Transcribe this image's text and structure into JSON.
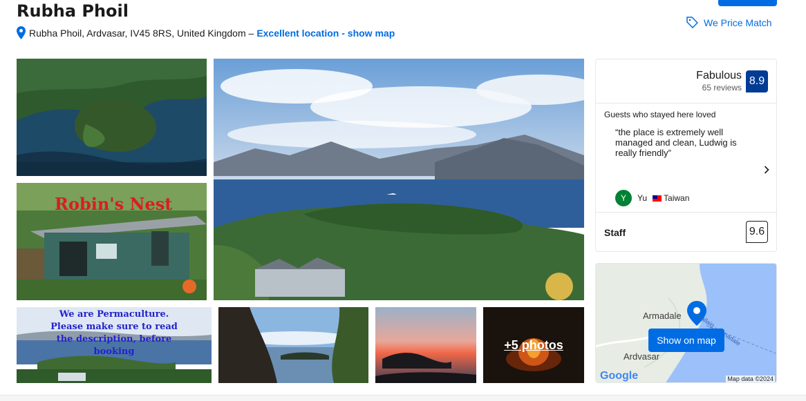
{
  "hotel": {
    "name": "Rubha Phoil",
    "address": "Rubha Phoil, Ardvasar, IV45 8RS, United Kingdom –",
    "location_link": "Excellent location - show map"
  },
  "price_match": {
    "label": "We Price Match",
    "icon": "tag-icon"
  },
  "gallery": {
    "photo2_sign": "Robin's Nest",
    "photo4_text_line1": "We are Permaculture.",
    "photo4_text_line2": "Please make sure to read",
    "photo4_text_line3": "the description, before",
    "photo4_text_line4": "booking",
    "more_photos": "+5 photos"
  },
  "reviews": {
    "score_word": "Fabulous",
    "review_count": "65 reviews",
    "score": "8.9",
    "loved_heading": "Guests who stayed here loved",
    "quote": "“the place is extremely well managed and clean, Ludwig is really friendly”",
    "reviewer_initial": "Y",
    "reviewer_name": "Yu",
    "reviewer_country": "Taiwan",
    "category_label": "Staff",
    "category_score": "9.6"
  },
  "map": {
    "button_label": "Show on map",
    "label_armadale": "Armadale",
    "label_ardvasar": "Ardvasar",
    "ferry_label": "Mallaig - Armadale",
    "google_logo": "Google",
    "credit": "Map data ©2024"
  },
  "colors": {
    "accent": "#006ce4",
    "score_badge": "#003b95",
    "avatar": "#008234"
  }
}
